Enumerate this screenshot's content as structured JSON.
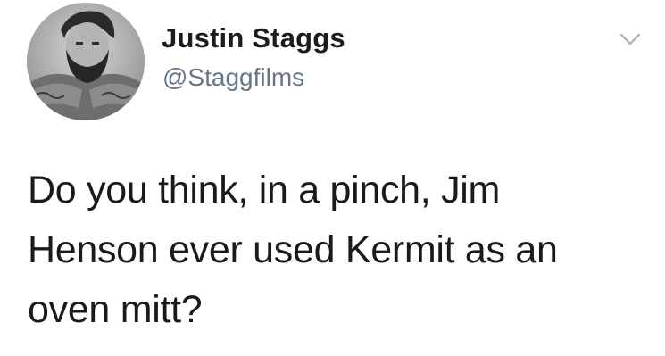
{
  "author": {
    "display_name": "Justin Staggs",
    "handle": "@Staggfilms",
    "avatar_icon": "user-avatar-photo"
  },
  "tweet": {
    "text": "Do you think, in a pinch, Jim\nHenson ever used Kermit as an\noven mitt?"
  },
  "menu": {
    "icon": "chevron-down-icon"
  },
  "colors": {
    "name": "#1c1c1c",
    "handle": "#657786",
    "text": "#1a1a1a",
    "background": "#ffffff",
    "chevron": "#aab8c2"
  }
}
